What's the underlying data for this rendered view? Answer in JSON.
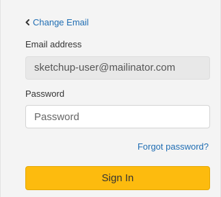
{
  "nav": {
    "back_label": "Change Email",
    "back_icon": "chevron-left-icon"
  },
  "form": {
    "email_label": "Email address",
    "email_value": "sketchup-user@mailinator.com",
    "password_label": "Password",
    "password_placeholder": "Password",
    "password_value": "",
    "forgot_label": "Forgot password?",
    "submit_label": "Sign In"
  },
  "colors": {
    "link": "#1f6db3",
    "button_bg": "#fdbb0e",
    "page_bg": "#f4f4f4"
  }
}
